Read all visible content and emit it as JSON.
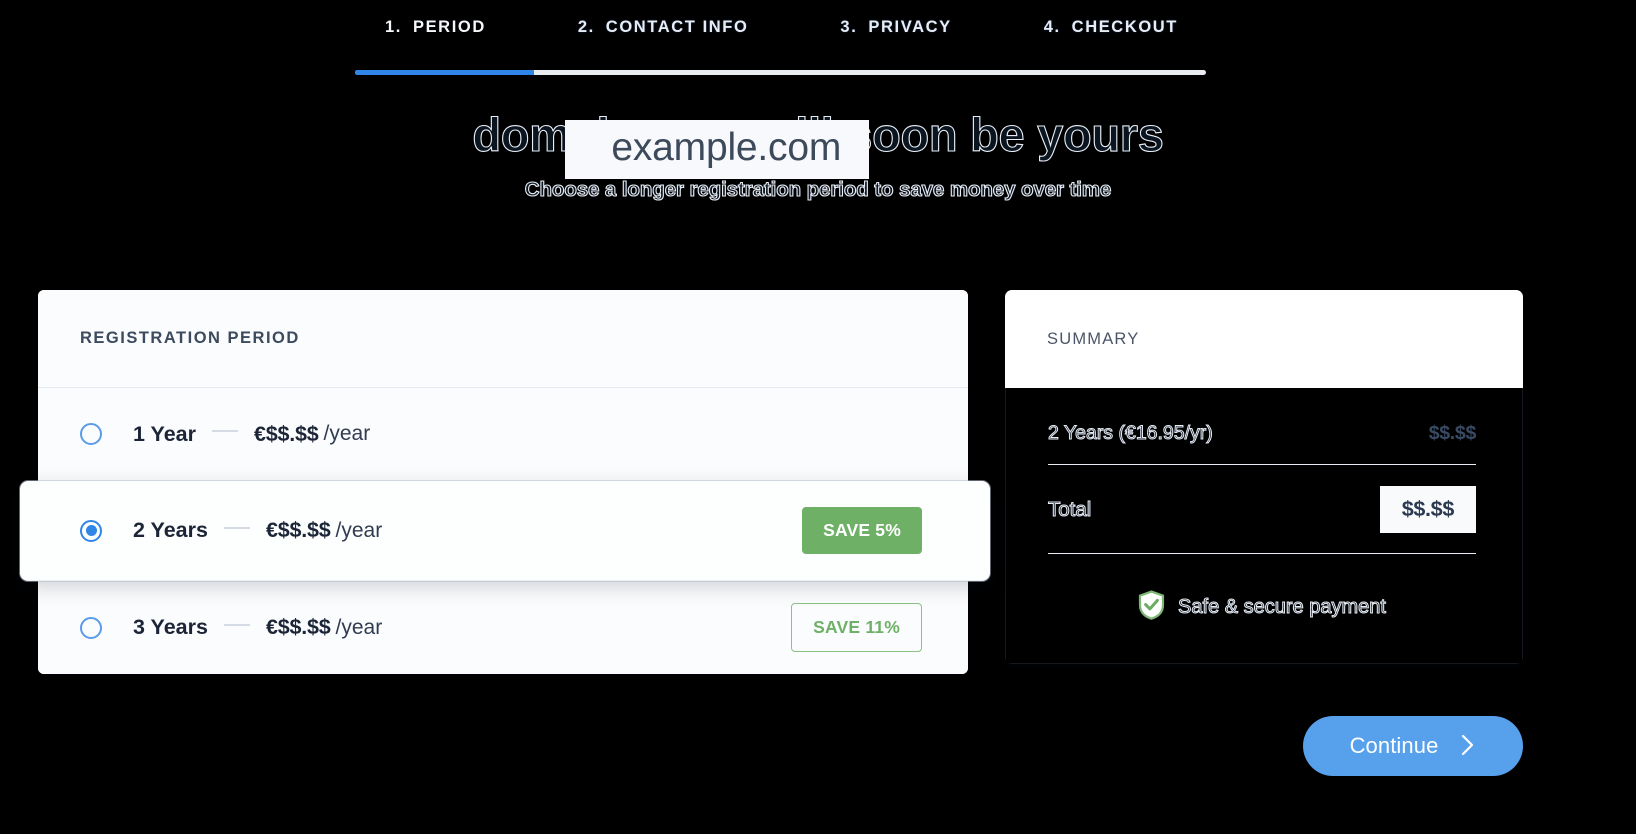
{
  "stepper": {
    "steps": [
      {
        "num": "1.",
        "label": "PERIOD",
        "active": true
      },
      {
        "num": "2.",
        "label": "CONTACT INFO",
        "active": false
      },
      {
        "num": "3.",
        "label": "PRIVACY",
        "active": false
      },
      {
        "num": "4.",
        "label": "CHECKOUT",
        "active": false
      }
    ],
    "progress_percent": 21
  },
  "hero": {
    "title_prefix": "domain.com",
    "title_suffix": " will soon be yours",
    "domain": "example.com",
    "subtitle": "Choose a longer registration period to save money over time"
  },
  "period_card": {
    "title": "REGISTRATION PERIOD",
    "options": [
      {
        "term": "1 Year",
        "price": "€$$.$$",
        "per": "/year",
        "selected": false,
        "badge": null,
        "badge_style": null
      },
      {
        "term": "2 Years",
        "price": "€$$.$$",
        "per": "/year",
        "selected": true,
        "badge": "SAVE 5%",
        "badge_style": "solid"
      },
      {
        "term": "3 Years",
        "price": "€$$.$$",
        "per": "/year",
        "selected": false,
        "badge": "SAVE 11%",
        "badge_style": "outline"
      }
    ]
  },
  "summary": {
    "title": "SUMMARY",
    "line_label": "2 Years (€16.95/yr)",
    "line_value": "$$.$$",
    "total_label": "Total",
    "total_value": "$$.$$",
    "secure_text": "Safe & secure payment"
  },
  "footer": {
    "continue_label": "Continue"
  },
  "colors": {
    "accent_blue": "#2f86e8",
    "button_blue": "#57a0ec",
    "save_green": "#6fb067",
    "background": "#000000",
    "card_light": "#fbfcfd"
  }
}
